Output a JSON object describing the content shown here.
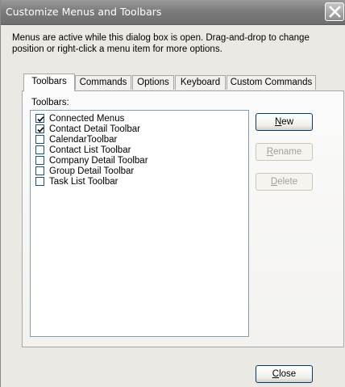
{
  "window": {
    "title": "Customize Menus and Toolbars",
    "close_icon": "close-icon"
  },
  "instructions": {
    "line1": "Menus are active while this dialog box is open. Drag-and-drop to change",
    "line2": "position or right-click a menu item for more options."
  },
  "tabs": [
    {
      "label": "Toolbars",
      "active": true
    },
    {
      "label": "Commands",
      "active": false
    },
    {
      "label": "Options",
      "active": false
    },
    {
      "label": "Keyboard",
      "active": false
    },
    {
      "label": "Custom Commands",
      "active": false
    }
  ],
  "toolbars_panel": {
    "group_label": "Toolbars:",
    "items": [
      {
        "label": "Connected Menus",
        "checked": true
      },
      {
        "label": "Contact Detail Toolbar",
        "checked": true
      },
      {
        "label": "CalendarToolbar",
        "checked": false
      },
      {
        "label": "Contact List Toolbar",
        "checked": false
      },
      {
        "label": "Company Detail Toolbar",
        "checked": false
      },
      {
        "label": "Group Detail Toolbar",
        "checked": false
      },
      {
        "label": "Task List Toolbar",
        "checked": false
      }
    ],
    "buttons": {
      "new": {
        "mnemonic": "N",
        "rest": "ew",
        "enabled": true
      },
      "rename": {
        "mnemonic": "R",
        "rest": "ename",
        "enabled": false
      },
      "delete": {
        "mnemonic": "D",
        "rest": "elete",
        "enabled": false
      }
    }
  },
  "footer": {
    "close": {
      "mnemonic": "C",
      "rest": "lose"
    }
  },
  "colors": {
    "title_bar": "#7c7c7c",
    "dialog_bg": "#ebe9e3",
    "button_border": "#003c74",
    "disabled_text": "#a3a198"
  }
}
